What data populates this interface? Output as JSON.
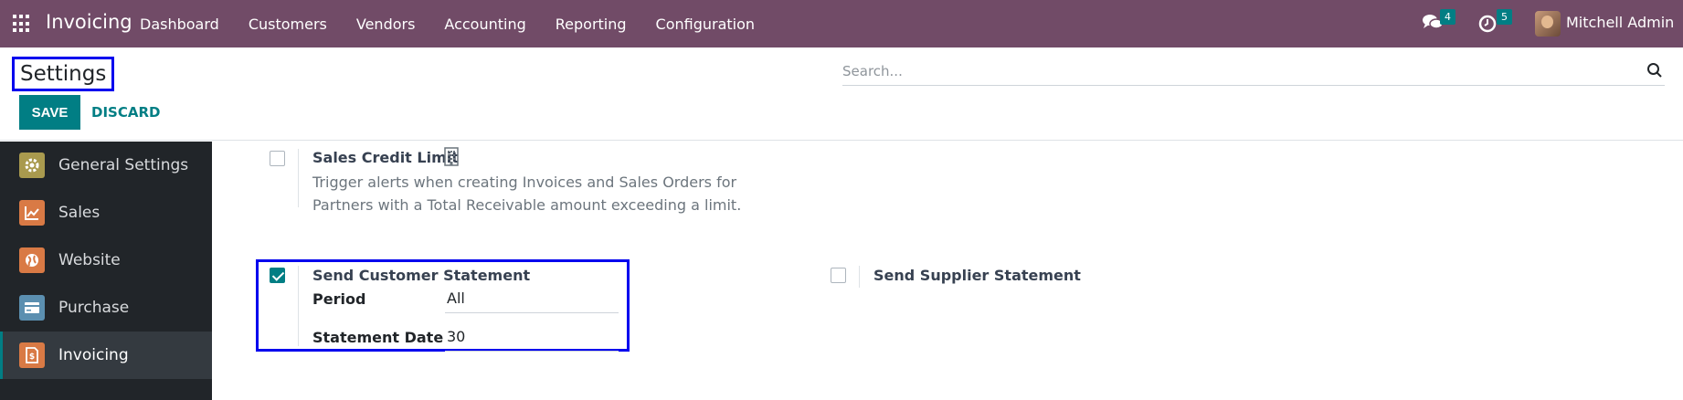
{
  "navbar": {
    "app_name": "Invoicing",
    "menu": [
      "Dashboard",
      "Customers",
      "Vendors",
      "Accounting",
      "Reporting",
      "Configuration"
    ],
    "messages_count": "4",
    "activities_count": "5",
    "user_name": "Mitchell Admin"
  },
  "control_panel": {
    "title": "Settings",
    "search_placeholder": "Search...",
    "save_label": "SAVE",
    "discard_label": "DISCARD"
  },
  "sidebar": {
    "items": [
      {
        "label": "General Settings",
        "icon": "gear-icon",
        "color": "#a99a4e"
      },
      {
        "label": "Sales",
        "icon": "chart-icon",
        "color": "#d97a45"
      },
      {
        "label": "Website",
        "icon": "globe-icon",
        "color": "#d97a45"
      },
      {
        "label": "Purchase",
        "icon": "card-icon",
        "color": "#5b8fb0"
      },
      {
        "label": "Invoicing",
        "icon": "invoice-icon",
        "color": "#d97a45"
      }
    ],
    "active": "Invoicing"
  },
  "settings": {
    "sales_credit_limit": {
      "title": "Sales Credit Limit",
      "description": "Trigger alerts when creating Invoices and Sales Orders for Partners with a Total Receivable amount exceeding a limit.",
      "checked": false
    },
    "send_customer_statement": {
      "title": "Send Customer Statement",
      "checked": true,
      "period_label": "Period",
      "period_value": "All",
      "statement_date_label": "Statement Date",
      "statement_date_value": "30"
    },
    "send_supplier_statement": {
      "title": "Send Supplier Statement",
      "checked": false
    }
  },
  "colors": {
    "navbar": "#714b67",
    "primary": "#017e84",
    "highlight": "#0000ee"
  }
}
